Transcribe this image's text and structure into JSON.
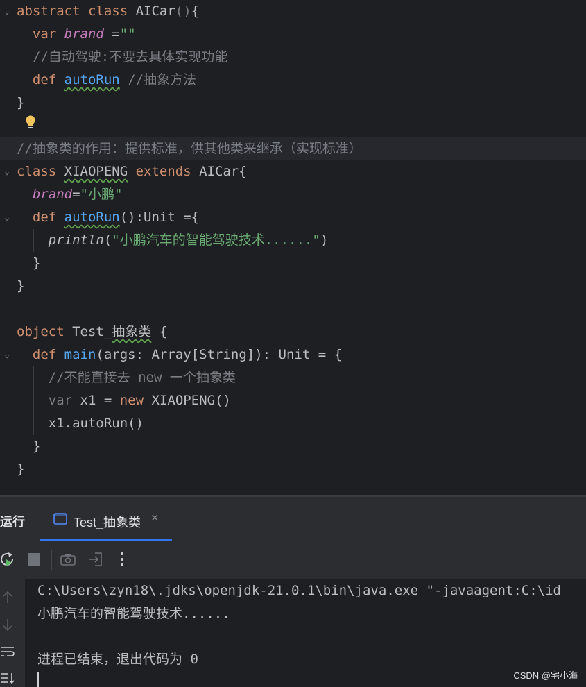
{
  "editor": {
    "lines": [
      {
        "segs": [
          {
            "t": "abstract class ",
            "c": "kw"
          },
          {
            "t": "AICar"
          },
          {
            "t": "()",
            "c": "cmt"
          },
          {
            "t": "{"
          }
        ]
      },
      {
        "segs": [
          {
            "t": "  "
          },
          {
            "t": "var ",
            "c": "kw"
          },
          {
            "t": "brand",
            "c": "field"
          },
          {
            "t": " ="
          },
          {
            "t": "\"\"",
            "c": "str"
          }
        ]
      },
      {
        "segs": [
          {
            "t": "  //自动驾驶:不要去具体实现功能",
            "c": "cmt"
          }
        ]
      },
      {
        "segs": [
          {
            "t": "  "
          },
          {
            "t": "def ",
            "c": "kw"
          },
          {
            "t": "autoRun",
            "c": "fn squig"
          },
          {
            "t": " //抽象方法",
            "c": "cmt"
          }
        ]
      },
      {
        "segs": [
          {
            "t": "}"
          }
        ]
      },
      {
        "segs": []
      },
      {
        "segs": [
          {
            "t": "//抽象类的作用：提供标准，供其他类来继承（实现标准）",
            "c": "cmt"
          }
        ]
      },
      {
        "segs": [
          {
            "t": "class ",
            "c": "kw"
          },
          {
            "t": "XIAOPENG",
            "c": "squig"
          },
          {
            "t": " extends ",
            "c": "kw"
          },
          {
            "t": "AICar{"
          }
        ]
      },
      {
        "segs": [
          {
            "t": "  "
          },
          {
            "t": "brand",
            "c": "field"
          },
          {
            "t": "="
          },
          {
            "t": "\"小鹏\"",
            "c": "str"
          }
        ]
      },
      {
        "segs": [
          {
            "t": "  "
          },
          {
            "t": "def ",
            "c": "kw"
          },
          {
            "t": "autoRun",
            "c": "fn squig"
          },
          {
            "t": "():Unit ={"
          }
        ]
      },
      {
        "segs": [
          {
            "t": "    "
          },
          {
            "t": "println",
            "c": "italic"
          },
          {
            "t": "("
          },
          {
            "t": "\"小鹏汽车的智能驾驶技术......\"",
            "c": "str"
          },
          {
            "t": ")"
          }
        ]
      },
      {
        "segs": [
          {
            "t": "  }"
          }
        ]
      },
      {
        "segs": [
          {
            "t": "}"
          }
        ]
      },
      {
        "segs": []
      },
      {
        "segs": [
          {
            "t": "object ",
            "c": "kw"
          },
          {
            "t": "Test_"
          },
          {
            "t": "抽象类",
            "c": "squig"
          },
          {
            "t": " {"
          }
        ]
      },
      {
        "segs": [
          {
            "t": "  "
          },
          {
            "t": "def ",
            "c": "kw"
          },
          {
            "t": "main",
            "c": "fn"
          },
          {
            "t": "(args: Array[String]): Unit = {"
          }
        ]
      },
      {
        "segs": [
          {
            "t": "    //不能直接去 new 一个抽象类",
            "c": "cmt"
          }
        ]
      },
      {
        "segs": [
          {
            "t": "    "
          },
          {
            "t": "var ",
            "c": "cmt"
          },
          {
            "t": "x1 = "
          },
          {
            "t": "new ",
            "c": "kw"
          },
          {
            "t": "XIAOPENG()"
          }
        ]
      },
      {
        "segs": [
          {
            "t": "    x1.autoRun()"
          }
        ]
      },
      {
        "segs": [
          {
            "t": "  }"
          }
        ]
      },
      {
        "segs": [
          {
            "t": "}"
          }
        ]
      }
    ]
  },
  "run_panel": {
    "label": "运行",
    "tab_label": "Test_抽象类",
    "close_glyph": "×"
  },
  "console": {
    "lines": [
      "C:\\Users\\zyn18\\.jdks\\openjdk-21.0.1\\bin\\java.exe \"-javaagent:C:\\id",
      "小鹏汽车的智能驾驶技术......",
      "",
      "进程已结束，退出代码为 0"
    ]
  },
  "watermark": "CSDN @宅小海",
  "colors": {
    "keyword": "#cf8e6d",
    "field": "#c77dbb",
    "function": "#56a8f5",
    "string": "#6aab73",
    "comment": "#7a7e85",
    "accent": "#3574f0"
  }
}
